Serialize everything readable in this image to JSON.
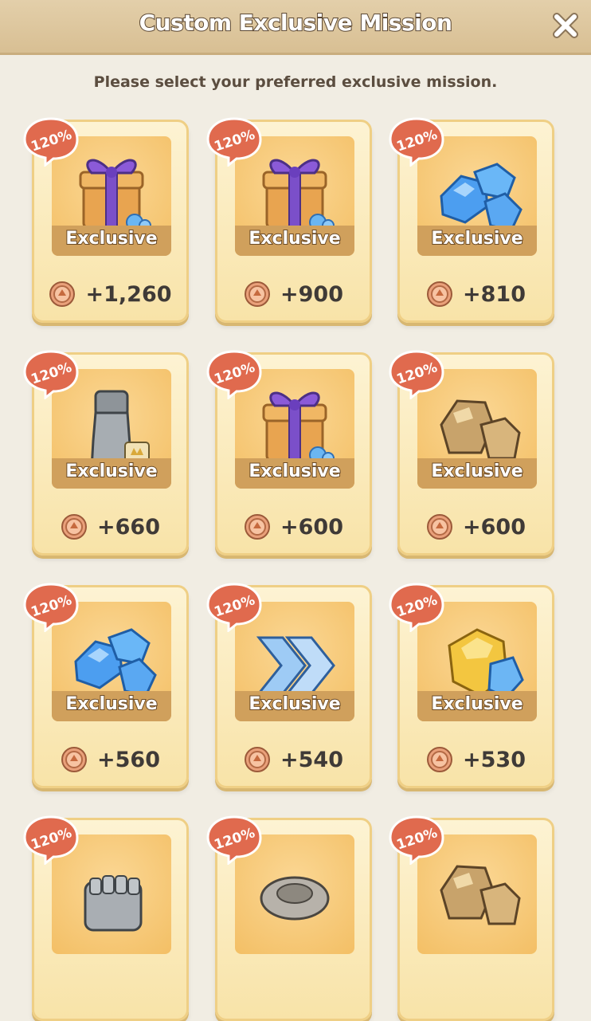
{
  "header": {
    "title": "Custom Exclusive Mission"
  },
  "subtitle": "Please select your preferred exclusive mission.",
  "colors": {
    "badge": "#e06a4e",
    "card": "#f8e3a8",
    "strip": "#d0a05c"
  },
  "missions": [
    {
      "badge": "120%",
      "label": "Exclusive",
      "reward": "+1,260",
      "item": "gift-box-icon"
    },
    {
      "badge": "120%",
      "label": "Exclusive",
      "reward": "+900",
      "item": "gift-box-icon"
    },
    {
      "badge": "120%",
      "label": "Exclusive",
      "reward": "+810",
      "item": "blue-gems-icon"
    },
    {
      "badge": "120%",
      "label": "Exclusive",
      "reward": "+660",
      "item": "armor-boot-icon"
    },
    {
      "badge": "120%",
      "label": "Exclusive",
      "reward": "+600",
      "item": "gift-box-icon"
    },
    {
      "badge": "120%",
      "label": "Exclusive",
      "reward": "+600",
      "item": "gold-ore-icon"
    },
    {
      "badge": "120%",
      "label": "Exclusive",
      "reward": "+560",
      "item": "blue-gems-icon"
    },
    {
      "badge": "120%",
      "label": "Exclusive",
      "reward": "+540",
      "item": "speed-chevrons-icon"
    },
    {
      "badge": "120%",
      "label": "Exclusive",
      "reward": "+530",
      "item": "yellow-gem-icon"
    },
    {
      "badge": "120%",
      "label": "",
      "reward": "",
      "item": "silver-gauntlet-icon"
    },
    {
      "badge": "120%",
      "label": "",
      "reward": "",
      "item": "stone-ring-icon"
    },
    {
      "badge": "120%",
      "label": "",
      "reward": "",
      "item": "gold-ore-icon"
    }
  ]
}
